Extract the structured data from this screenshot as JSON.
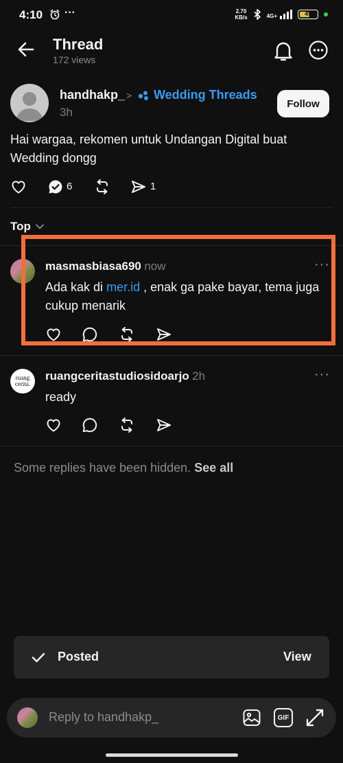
{
  "status_bar": {
    "time": "4:10",
    "speed_value": "2.70",
    "speed_unit": "KB/s",
    "network": "4G+",
    "battery": "49"
  },
  "header": {
    "title": "Thread",
    "views": "172 views"
  },
  "post": {
    "username": "handhakp_",
    "community": "Wedding Threads",
    "time": "3h",
    "follow_label": "Follow",
    "text": "Hai wargaa, rekomen untuk Undangan Digital buat Wedding dongg",
    "reply_count": "6",
    "share_count": "1"
  },
  "sort": {
    "label": "Top"
  },
  "replies": [
    {
      "username": "masmasbiasa690",
      "time": "now",
      "text_before": "Ada kak di ",
      "link": "mer.id",
      "text_after": " , enak ga pake bayar, tema juga cukup menarik"
    },
    {
      "username": "ruangceritastudiosidoarjo",
      "time": "2h",
      "text": "ready",
      "avatar_line1": "ruang",
      "avatar_line2": "cerita."
    }
  ],
  "hidden_replies": {
    "text": "Some replies have been hidden.",
    "link": "See all"
  },
  "toast": {
    "label": "Posted",
    "action": "View"
  },
  "composer": {
    "placeholder": "Reply to handhakp_",
    "gif_label": "GIF"
  },
  "colors": {
    "background": "#101010",
    "link": "#3a9bf1",
    "highlight": "#f26f3a",
    "battery": "#e2c147"
  }
}
